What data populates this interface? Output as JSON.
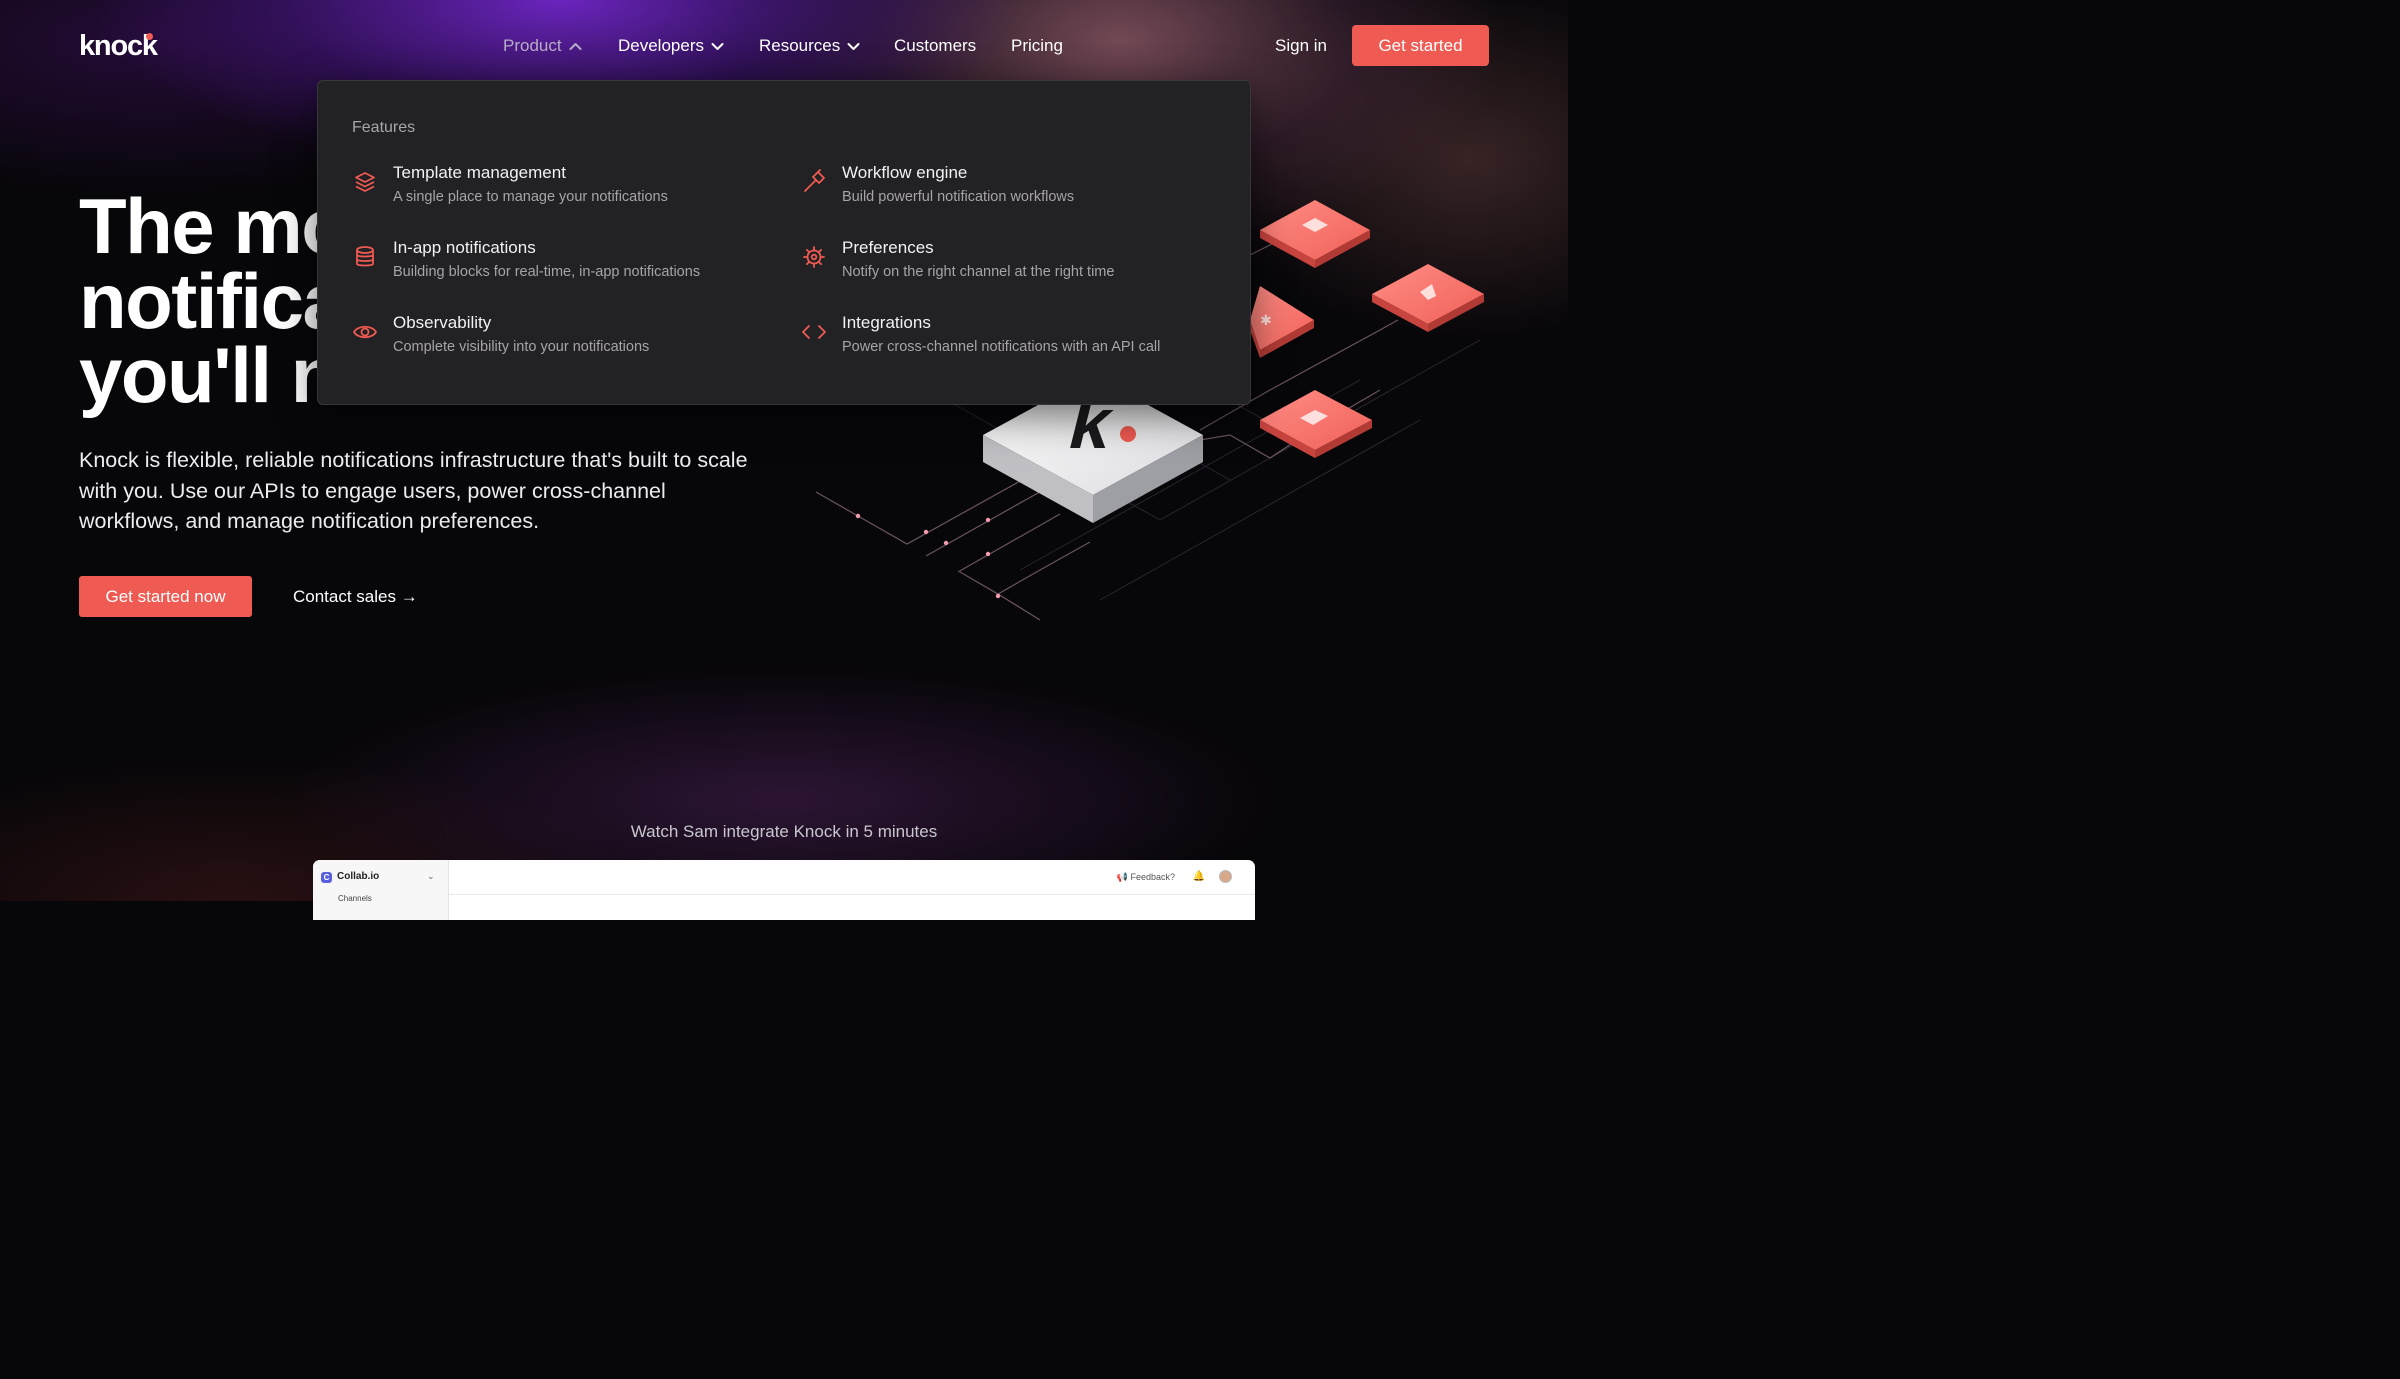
{
  "header": {
    "logo": "knock",
    "nav": [
      {
        "label": "Product",
        "active": true,
        "has_dropdown": true
      },
      {
        "label": "Developers",
        "active": false,
        "has_dropdown": true
      },
      {
        "label": "Resources",
        "active": false,
        "has_dropdown": true
      },
      {
        "label": "Customers",
        "active": false,
        "has_dropdown": false
      },
      {
        "label": "Pricing",
        "active": false,
        "has_dropdown": false
      }
    ],
    "sign_in": "Sign in",
    "get_started": "Get started"
  },
  "dropdown": {
    "heading": "Features",
    "items": [
      {
        "title": "Template management",
        "desc": "A single place to manage your notifications",
        "icon": "layers-icon"
      },
      {
        "title": "Workflow engine",
        "desc": "Build powerful notification workflows",
        "icon": "hammer-icon"
      },
      {
        "title": "In-app notifications",
        "desc": "Building blocks for real-time, in-app notifications",
        "icon": "database-icon"
      },
      {
        "title": "Preferences",
        "desc": "Notify on the right channel at the right time",
        "icon": "gear-icon"
      },
      {
        "title": "Observability",
        "desc": "Complete visibility into your notifications",
        "icon": "eye-icon"
      },
      {
        "title": "Integrations",
        "desc": "Power cross-channel notifications with an API call",
        "icon": "code-icon"
      }
    ]
  },
  "hero": {
    "lines": [
      "The mo",
      "notifica",
      "you'll n"
    ],
    "description": "Knock is flexible, reliable notifications infrastructure that's built to scale with you. Use our APIs to engage users, power cross-channel workflows, and manage notification preferences.",
    "cta_primary": "Get started now",
    "cta_secondary": "Contact sales →"
  },
  "video": {
    "caption": "Watch Sam integrate Knock in 5 minutes",
    "app_logo": "C",
    "app_name": "Collab.io",
    "sidebar_item": "Channels",
    "feedback": "Feedback?"
  },
  "colors": {
    "accent": "#ef5a52",
    "dropdown_bg": "#222123",
    "page_bg": "#070609"
  }
}
